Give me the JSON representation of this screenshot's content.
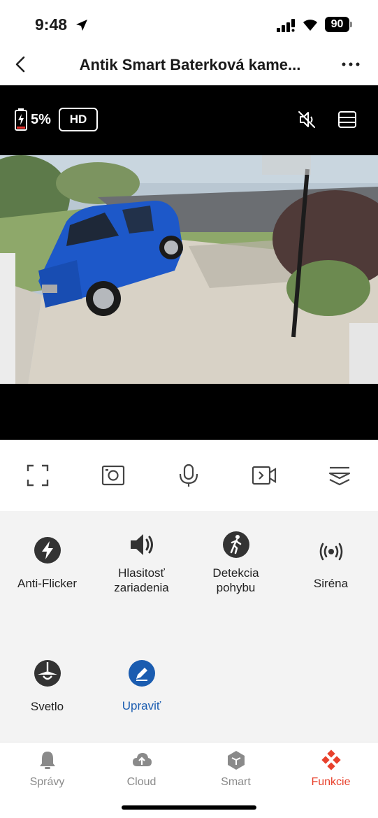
{
  "status_bar": {
    "time": "9:48",
    "battery_level": "90"
  },
  "nav": {
    "title": "Antik Smart Baterková kame..."
  },
  "video": {
    "battery_pct": "5%",
    "quality": "HD"
  },
  "controls": [
    "fullscreen-icon",
    "snapshot-icon",
    "microphone-icon",
    "record-video-icon",
    "more-controls-icon"
  ],
  "features": [
    {
      "label": "Anti-Flicker",
      "icon": "flash-icon"
    },
    {
      "label": "Hlasitosť\nzariadenia",
      "icon": "speaker-icon"
    },
    {
      "label": "Detekcia\npohybu",
      "icon": "walking-person-icon"
    },
    {
      "label": "Siréna",
      "icon": "siren-icon"
    },
    {
      "label": "Svetlo",
      "icon": "lamp-icon"
    },
    {
      "label": "Upraviť",
      "icon": "edit-icon"
    }
  ],
  "tabs": [
    {
      "label": "Správy",
      "icon": "bell-icon"
    },
    {
      "label": "Cloud",
      "icon": "cloud-upload-icon"
    },
    {
      "label": "Smart",
      "icon": "cube-icon"
    },
    {
      "label": "Funkcie",
      "icon": "grid-diamond-icon"
    }
  ],
  "colors": {
    "accent": "#e8412c",
    "edit_blue": "#1a5cb0",
    "panel_bg": "#f3f3f3"
  }
}
